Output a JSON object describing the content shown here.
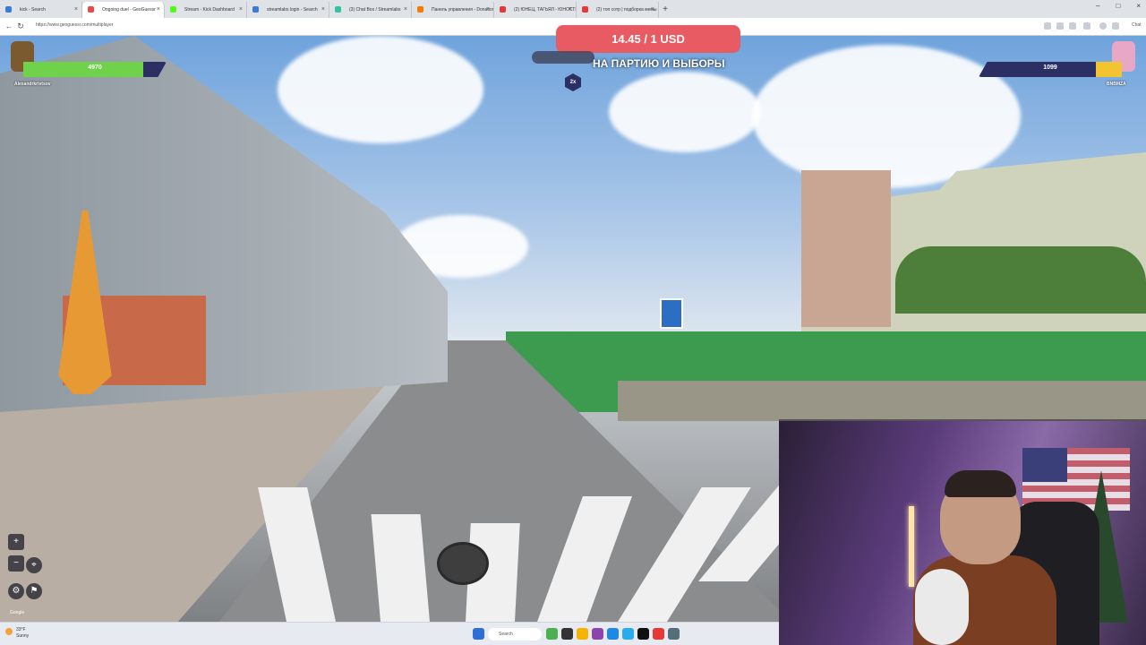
{
  "browser": {
    "tabs": [
      {
        "label": "kick - Search",
        "color": "#3b7bd6"
      },
      {
        "label": "Ongoing duel - GeoGuessr",
        "color": "#e64b4b"
      },
      {
        "label": "Stream - Kick Dashboard",
        "color": "#53fc18"
      },
      {
        "label": "streamlabs login - Search",
        "color": "#3b7bd6"
      },
      {
        "label": "(3) Chat Box / Streamlabs",
        "color": "#31c3a2"
      },
      {
        "label": "Панель управления - DonationA",
        "color": "#f57c00"
      },
      {
        "label": "(2) ЮНЕЦ, ТАГЬЯЛ - ЮНОСТЬ В",
        "color": "#e53935"
      },
      {
        "label": "(2) топ сотр | подборка мемы",
        "color": "#e53935"
      }
    ],
    "active_tab_index": 1,
    "url": "https://www.geoguessr.com/multiplayer",
    "new_tab_symbol": "+",
    "close_symbol": "×",
    "window_controls": {
      "minimize": "–",
      "maximize": "□",
      "close": "×"
    },
    "profile_label": "Chat"
  },
  "game": {
    "price_banner": "14.45 / 1 USD",
    "announcement": "НА ПАРТИЮ И ВЫБОРЫ",
    "multiplier": "2x",
    "player_left": {
      "name": "Alexandrkrivtsov",
      "health": 4970,
      "health_fraction": 0.84,
      "bar_color": "#6fd24a"
    },
    "player_right": {
      "name": "BNBMZA",
      "health": 1099,
      "health_fraction": 0.18,
      "bar_color": "#f2c430"
    },
    "map_controls": {
      "zoom_in": "+",
      "zoom_out": "−"
    },
    "google_label": "Google"
  },
  "taskbar": {
    "weather_temp": "33°F",
    "weather_desc": "Sunny",
    "search_placeholder": "Search"
  }
}
